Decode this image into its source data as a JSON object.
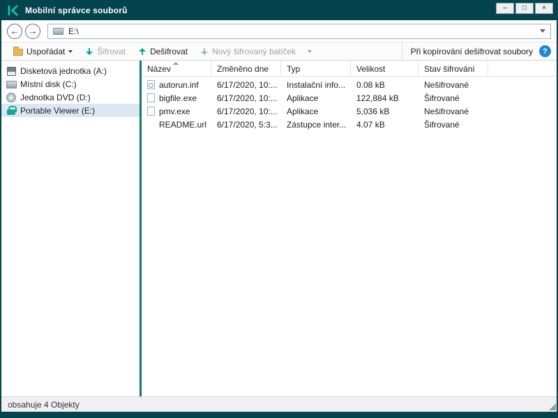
{
  "window": {
    "title": "Mobilní správce souborů",
    "controls": {
      "minimize": "–",
      "maximize": "□",
      "close": "×"
    }
  },
  "navigation": {
    "address": "E:\\"
  },
  "toolbar": {
    "organize_label": "Uspořádat",
    "encrypt_label": "Šifrovat",
    "decrypt_label": "Dešifrovat",
    "new_package_label": "Nový šifrovaný balíček",
    "copy_option_label": "Při kopírování dešifrovat soubory"
  },
  "sidebar": {
    "items": [
      {
        "label": "Disketová jednotka (A:)",
        "icon": "floppy-drive-icon",
        "selected": false
      },
      {
        "label": "Místní disk (C:)",
        "icon": "hard-disk-icon",
        "selected": false
      },
      {
        "label": "Jednotka DVD (D:)",
        "icon": "dvd-drive-icon",
        "selected": false
      },
      {
        "label": "Portable Viewer (E:)",
        "icon": "lock-icon",
        "selected": true
      }
    ]
  },
  "filelist": {
    "columns": [
      "Název",
      "Změněno dne",
      "Typ",
      "Velikost",
      "Stav šifrování"
    ],
    "rows": [
      {
        "icon": "gear-file-icon",
        "name": "autorun.inf",
        "modified": "6/17/2020, 10:...",
        "type": "Instalační info...",
        "size": "0.08 kB",
        "status": "Nešifrované"
      },
      {
        "icon": "file-icon",
        "name": "bigfile.exe",
        "modified": "6/17/2020, 10:...",
        "type": "Aplikace",
        "size": "122,884 kB",
        "status": "Šifrované"
      },
      {
        "icon": "file-icon",
        "name": "pmv.exe",
        "modified": "6/17/2020, 10:...",
        "type": "Aplikace",
        "size": "5,036 kB",
        "status": "Nešifrované"
      },
      {
        "icon": "none",
        "name": "README.url",
        "modified": "6/17/2020, 5:3...",
        "type": "Zástupce inter...",
        "size": "4.07 kB",
        "status": "Šifrované"
      }
    ]
  },
  "statusbar": {
    "text": "obsahuje 4 Objekty"
  },
  "colors": {
    "titlebar": "#04444e",
    "accent_teal": "#0fa78f",
    "selection": "#dbe7f2",
    "help_blue": "#1f86d2"
  }
}
